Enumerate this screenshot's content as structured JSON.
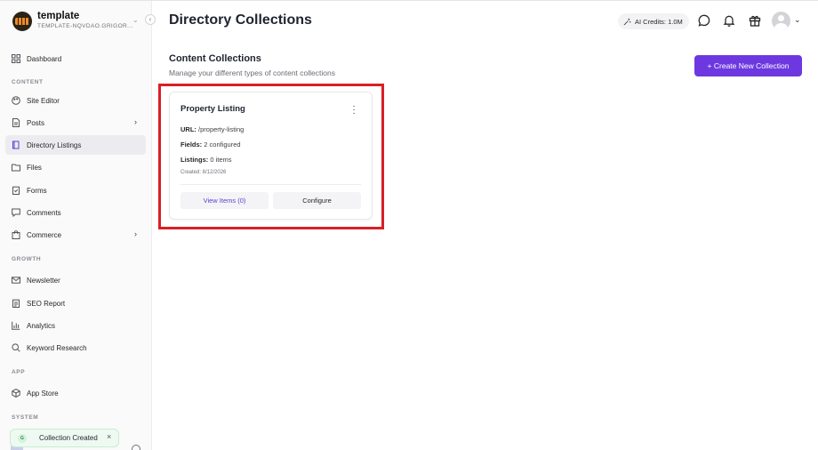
{
  "brand": {
    "name": "template",
    "subtitle": "TEMPLATE-NQVDAO.GRIGOR..."
  },
  "sidebar": {
    "items": [
      {
        "key": "dashboard",
        "label": "Dashboard",
        "icon": "dashboard-icon"
      },
      {
        "key": "site-editor",
        "label": "Site Editor",
        "icon": "palette-icon"
      },
      {
        "key": "posts",
        "label": "Posts",
        "icon": "document-icon",
        "expandable": true
      },
      {
        "key": "directory-listings",
        "label": "Directory Listings",
        "icon": "book-icon",
        "active": true
      },
      {
        "key": "files",
        "label": "Files",
        "icon": "folder-icon"
      },
      {
        "key": "forms",
        "label": "Forms",
        "icon": "clipboard-check-icon"
      },
      {
        "key": "comments",
        "label": "Comments",
        "icon": "comment-icon"
      },
      {
        "key": "commerce",
        "label": "Commerce",
        "icon": "shopping-bag-icon",
        "expandable": true
      },
      {
        "key": "newsletter",
        "label": "Newsletter",
        "icon": "mail-icon"
      },
      {
        "key": "seo-report",
        "label": "SEO Report",
        "icon": "report-icon"
      },
      {
        "key": "analytics",
        "label": "Analytics",
        "icon": "bar-chart-icon"
      },
      {
        "key": "keyword-research",
        "label": "Keyword Research",
        "icon": "search-icon"
      },
      {
        "key": "app-store",
        "label": "App Store",
        "icon": "package-icon"
      }
    ],
    "sections": {
      "content": "CONTENT",
      "growth": "GROWTH",
      "app": "APP",
      "system": "SYSTEM"
    }
  },
  "header": {
    "title": "Directory Collections",
    "ai_credits": "AI Credits: 1.0M"
  },
  "main": {
    "section_title": "Content Collections",
    "section_subtitle": "Manage your different types of content collections",
    "create_button": "+ Create New Collection",
    "card": {
      "title": "Property Listing",
      "url_label": "URL:",
      "url_value": "/property-listing",
      "fields_label": "Fields:",
      "fields_value": "2 configured",
      "listings_label": "Listings:",
      "listings_value": "0 items",
      "created": "Created: 8/12/2026",
      "view_button": "View Items (0)",
      "configure_button": "Configure"
    }
  },
  "toast": {
    "badge": "G",
    "message": "Collection Created",
    "close": "×"
  },
  "colors": {
    "accent": "#6d38e0",
    "highlight": "#d91f26",
    "active_bg": "#ececf0"
  }
}
